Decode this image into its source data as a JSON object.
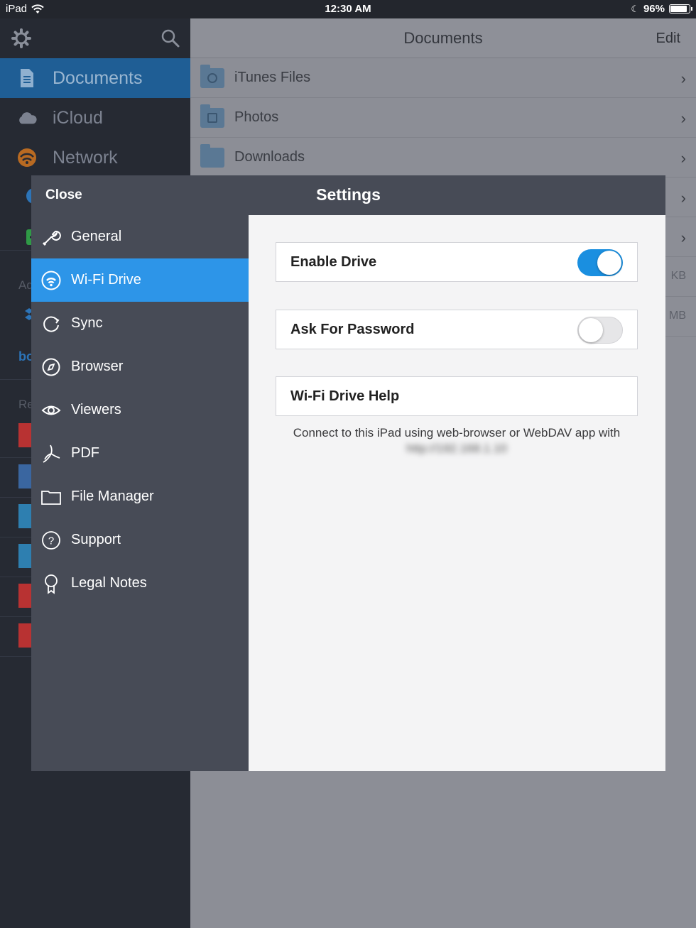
{
  "status_bar": {
    "device": "iPad",
    "time": "12:30 AM",
    "battery": "96%"
  },
  "sidebar": {
    "items": [
      {
        "label": "Documents",
        "icon": "document-icon",
        "active": true
      },
      {
        "label": "iCloud",
        "icon": "cloud-icon"
      },
      {
        "label": "Network",
        "icon": "wifi-icon"
      }
    ],
    "partial_labels": [
      "Ad",
      "Re"
    ]
  },
  "content": {
    "title": "Documents",
    "edit_label": "Edit",
    "files": [
      {
        "name": "iTunes Files"
      },
      {
        "name": "Photos"
      },
      {
        "name": "Downloads"
      }
    ],
    "size_labels": [
      "KB",
      "MB"
    ]
  },
  "settings": {
    "close_label": "Close",
    "title": "Settings",
    "nav": [
      {
        "label": "General",
        "icon": "wrench-icon"
      },
      {
        "label": "Wi-Fi Drive",
        "icon": "wifi-icon",
        "active": true
      },
      {
        "label": "Sync",
        "icon": "sync-icon"
      },
      {
        "label": "Browser",
        "icon": "compass-icon"
      },
      {
        "label": "Viewers",
        "icon": "eye-icon"
      },
      {
        "label": "PDF",
        "icon": "pdf-icon"
      },
      {
        "label": "File Manager",
        "icon": "folder-icon"
      },
      {
        "label": "Support",
        "icon": "help-icon"
      },
      {
        "label": "Legal Notes",
        "icon": "ribbon-icon"
      }
    ],
    "enable_drive": {
      "label": "Enable Drive",
      "on": true
    },
    "ask_password": {
      "label": "Ask For Password",
      "on": false
    },
    "help": {
      "label": "Wi-Fi Drive Help"
    },
    "connect_text": "Connect to this iPad using web-browser or WebDAV app with",
    "connect_address": "http://192.168.1.10"
  },
  "colors": {
    "accent": "#2d95e8",
    "toggle_on": "#1a8fe0",
    "modal_nav": "#474b56"
  }
}
